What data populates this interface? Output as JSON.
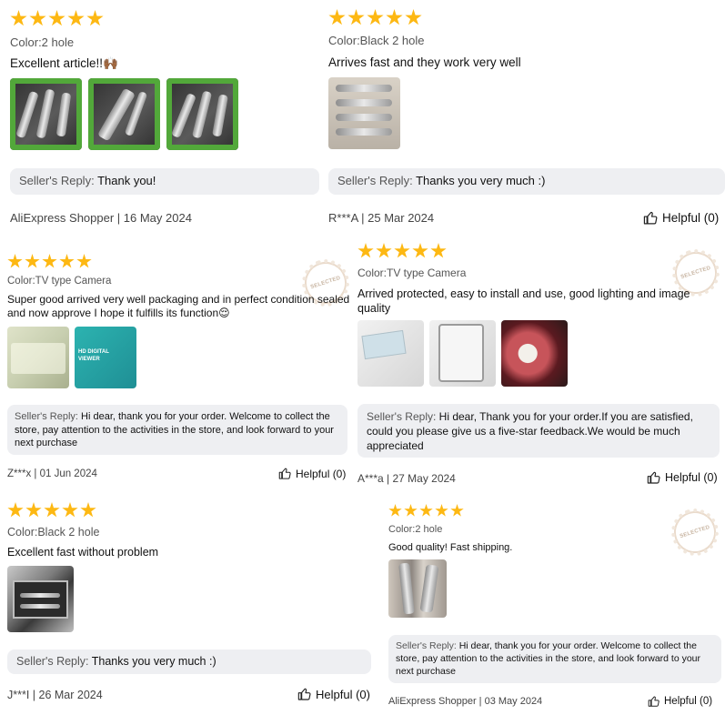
{
  "reviews": [
    {
      "color": "Color:2 hole",
      "text": "Excellent article!!",
      "emoji": "🙌🏾",
      "reply_label": "Seller's Reply:",
      "reply_text": "Thank you!",
      "author_date": "AliExpress Shopper | 16 May 2024",
      "photos": [
        "product-photo-handpieces-box",
        "product-photo-handpiece-closeup",
        "product-photo-handpieces-set"
      ]
    },
    {
      "color": "Color:Black 2 hole",
      "text": "Arrives fast and they work very well",
      "reply_label": "Seller's Reply:",
      "reply_text": "Thanks you very much :)",
      "author_date": "R***A | 25 Mar 2024",
      "helpful": "Helpful (0)",
      "photos": [
        "product-photo-handpieces-case"
      ]
    },
    {
      "color": "Color:TV type Camera",
      "text": "Super good arrived very well packaging and in perfect condition sealed and now approve I hope it fulfills its function",
      "emoji": "😌",
      "reply_label": "Seller's Reply:",
      "reply_text": "Hi dear, thank you for your order. Welcome to collect the store, pay attention to the activities in the store, and look forward to your next purchase",
      "author_date": "Z***x | 01 Jun 2024",
      "helpful": "Helpful (0)",
      "badge": "SELECTED",
      "photos": [
        "product-photo-sealed-package",
        "product-photo-hd-digital-viewer-box"
      ],
      "box_text": "HD DIGITAL VIEWER"
    },
    {
      "color": "Color:TV type Camera",
      "text": "Arrived protected, easy to install and use, good lighting and image quality",
      "reply_label": "Seller's Reply:",
      "reply_text": "Hi dear, Thank you for your order.If you are satisfied, could you please give us a five-star feedback.We would be much appreciated",
      "author_date": "A***a | 27 May 2024",
      "helpful": "Helpful (0)",
      "badge": "SELECTED",
      "photos": [
        "product-photo-camera-box",
        "product-photo-camera-cable",
        "product-photo-intraoral-image"
      ]
    },
    {
      "color": "Color:Black 2 hole",
      "text": "Excellent fast without problem",
      "reply_label": "Seller's Reply:",
      "reply_text": "Thanks you very much :)",
      "author_date": "J***I | 26 Mar 2024",
      "helpful": "Helpful (0)",
      "photos": [
        "product-photo-aluminum-case"
      ]
    },
    {
      "color": "Color:2 hole",
      "text": "Good quality! Fast shipping.",
      "reply_label": "Seller's Reply:",
      "reply_text": "Hi dear, thank you for your order. Welcome to collect the store, pay attention to the activities in the store, and look forward to your next purchase",
      "author_date": "AliExpress Shopper | 03 May 2024",
      "helpful": "Helpful (0)",
      "badge": "SELECTED",
      "photos": [
        "product-photo-handpiece-in-hand"
      ]
    }
  ],
  "colors": {
    "star": "#fdb813",
    "reply_bg": "#eeeff2",
    "muted": "#555555"
  }
}
